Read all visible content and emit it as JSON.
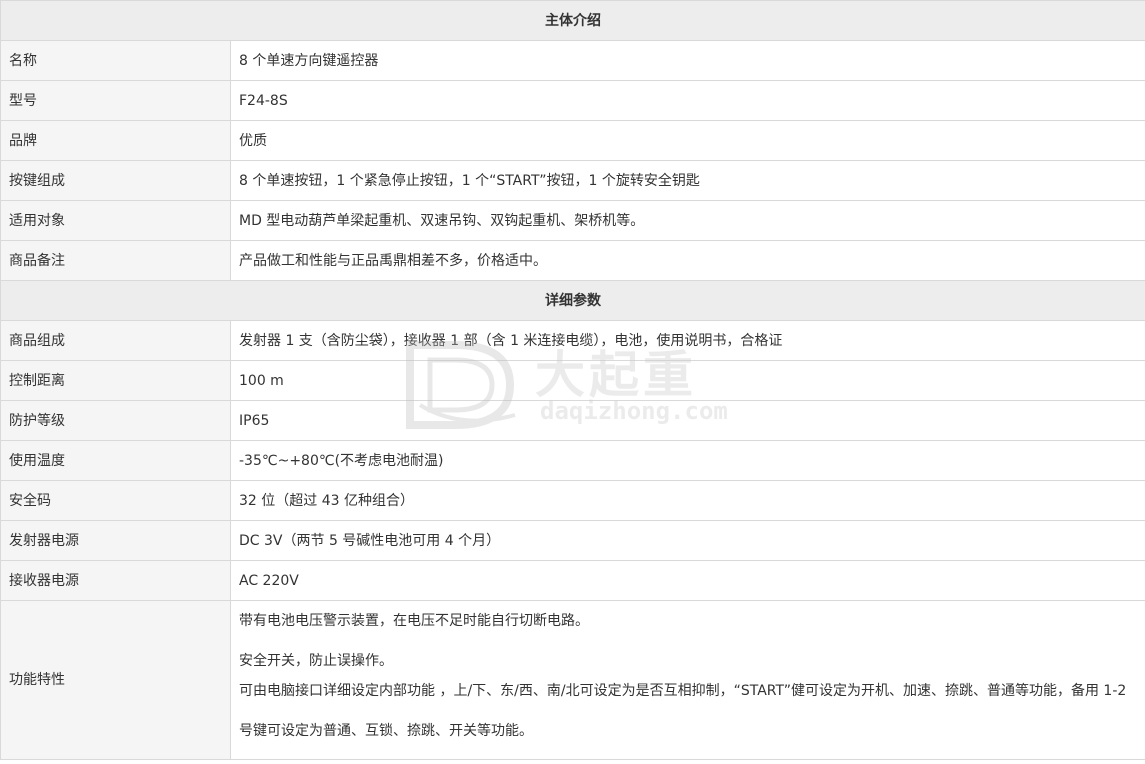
{
  "sections": {
    "intro_title": "主体介绍",
    "params_title": "详细参数"
  },
  "intro": [
    {
      "label": "名称",
      "value": "8 个单速方向键遥控器"
    },
    {
      "label": "型号",
      "value": "F24-8S"
    },
    {
      "label": "品牌",
      "value": "优质"
    },
    {
      "label": "按键组成",
      "value": "8 个单速按钮，1 个紧急停止按钮，1 个“START”按钮，1 个旋转安全钥匙"
    },
    {
      "label": "适用对象",
      "value": "MD 型电动葫芦单梁起重机、双速吊钩、双钩起重机、架桥机等。"
    },
    {
      "label": "商品备注",
      "value": "产品做工和性能与正品禹鼎相差不多，价格适中。"
    }
  ],
  "params": [
    {
      "label": "商品组成",
      "value": "发射器 1 支（含防尘袋），接收器 1 部（含 1 米连接电缆），电池，使用说明书，合格证"
    },
    {
      "label": "控制距离",
      "value": "100 m"
    },
    {
      "label": "防护等级",
      "value": "IP65"
    },
    {
      "label": "使用温度",
      "value": "-35℃~+80℃(不考虑电池耐温)"
    },
    {
      "label": "安全码",
      "value": "32 位（超过 43 亿种组合）"
    },
    {
      "label": "发射器电源",
      "value": "DC 3V（两节 5 号碱性电池可用 4 个月）"
    },
    {
      "label": "接收器电源",
      "value": "AC 220V"
    }
  ],
  "features": {
    "label": "功能特性",
    "lines": [
      "带有电池电压警示装置，在电压不足时能自行切断电路。",
      "安全开关，防止误操作。",
      "可由电脑接口详细设定内部功能 ，上/下、东/西、南/北可设定为是否互相抑制，“START”健可设定为开机、加速、捺跳、普通等功能，备用 1-2 号键可设定为普通、互锁、捺跳、开关等功能。"
    ]
  },
  "watermark": {
    "cn": "大起重",
    "en": "daqizhong.com"
  }
}
